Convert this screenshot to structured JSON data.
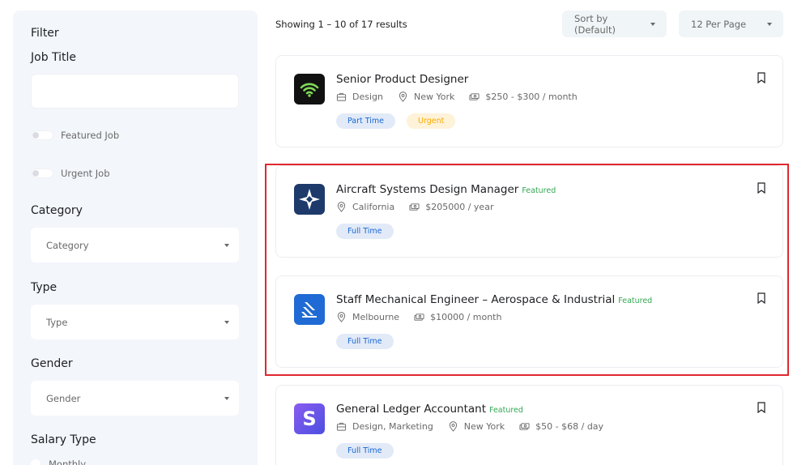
{
  "sidebar": {
    "filter_title": "Filter",
    "job_title_label": "Job Title",
    "featured_job_label": "Featured Job",
    "urgent_job_label": "Urgent Job",
    "category_label": "Category",
    "category_value": "Category",
    "type_label": "Type",
    "type_value": "Type",
    "gender_label": "Gender",
    "gender_value": "Gender",
    "salary_type_label": "Salary Type",
    "salary_option_monthly": "Monthly"
  },
  "topbar": {
    "results_text": "Showing 1 – 10 of 17 results",
    "sort_value": "Sort by (Default)",
    "per_page_value": "12 Per Page"
  },
  "jobs": [
    {
      "title": "Senior Product Designer",
      "featured": "",
      "category": "Design",
      "location": "New York",
      "salary": "$250 - $300 / month",
      "tags": [
        "Part Time",
        "Urgent"
      ],
      "logo_icon": "wifi-logo-icon",
      "logo_color": "#111111"
    },
    {
      "title": "Aircraft Systems Design Manager",
      "featured": "Featured",
      "category": "",
      "location": "California",
      "salary": "$205000 / year",
      "tags": [
        "Full Time"
      ],
      "logo_icon": "compass-star-logo-icon",
      "logo_color": "#1e3a6b"
    },
    {
      "title": "Staff Mechanical Engineer – Aerospace & Industrial",
      "featured": "Featured",
      "category": "",
      "location": "Melbourne",
      "salary": "$10000 / month",
      "tags": [
        "Full Time"
      ],
      "logo_icon": "stripes-logo-icon",
      "logo_color": "#1f6ad4"
    },
    {
      "title": "General Ledger Accountant",
      "featured": "Featured",
      "category": "Design, Marketing",
      "location": "New York",
      "salary": "$50 - $68 / day",
      "tags": [
        "Full Time"
      ],
      "logo_icon": "letter-s-logo-icon",
      "logo_color": "#6b4fe0"
    }
  ],
  "colors": {
    "accent_blue": "#1967d2",
    "featured_green": "#34a853",
    "urgent_orange": "#f9ab00",
    "highlight_red": "#e0272f"
  }
}
